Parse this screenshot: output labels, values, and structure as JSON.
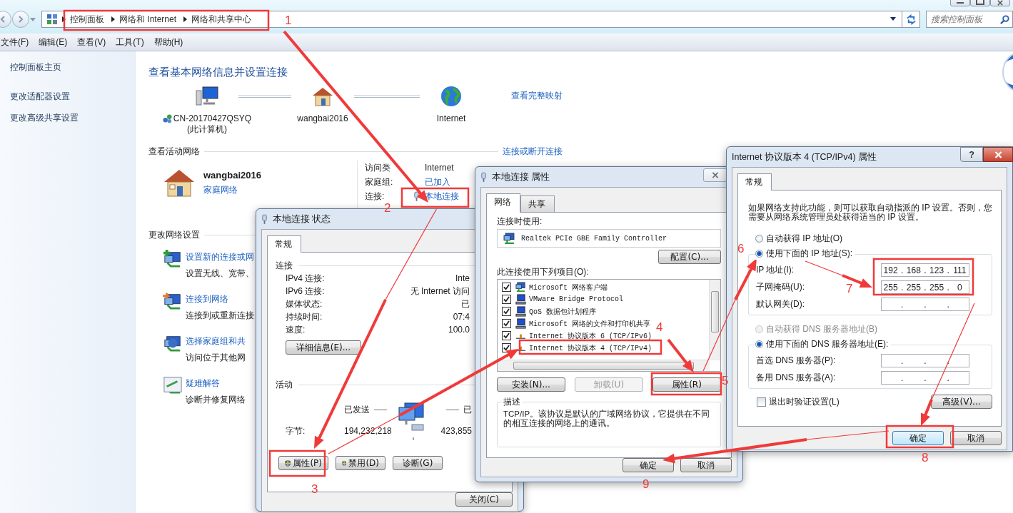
{
  "address_bar": {
    "breadcrumbs": [
      "控制面板",
      "网络和 Internet",
      "网络和共享中心"
    ]
  },
  "search": {
    "placeholder": "搜索控制面板"
  },
  "menu": [
    "文件(F)",
    "编辑(E)",
    "查看(V)",
    "工具(T)",
    "帮助(H)"
  ],
  "sidebar": {
    "items": [
      "控制面板主页",
      "更改适配器设置",
      "更改高级共享设置"
    ]
  },
  "main": {
    "title": "查看基本网络信息并设置连接",
    "full_map_link": "查看完整映射",
    "map_nodes": [
      {
        "kind": "computer",
        "label": "CN-20170427QSYQ",
        "sublabel": "(此计算机)"
      },
      {
        "kind": "home",
        "label": "wangbai2016"
      },
      {
        "kind": "internet",
        "label": "Internet"
      }
    ],
    "active_heading": "查看活动网络",
    "connect_link": "连接或断开连接",
    "network": {
      "name": "wangbai2016",
      "type": "家庭网络"
    },
    "details": [
      {
        "kind": "text",
        "label": "访问类",
        "value": "Internet"
      },
      {
        "kind": "link",
        "label": "家庭组:",
        "value": "已加入"
      },
      {
        "kind": "connection",
        "label": "连接:",
        "value": "本地连接"
      }
    ],
    "settings_heading": "更改网络设置",
    "tasks": [
      {
        "kind": "new",
        "title": "设置新的连接或网",
        "desc": "设置无线、宽带、"
      },
      {
        "kind": "connect",
        "title": "连接到网络",
        "desc": "连接到或重新连接"
      },
      {
        "kind": "homegroup",
        "title": "选择家庭组和共",
        "desc": "访问位于其他网"
      },
      {
        "kind": "troubleshoot",
        "title": "疑难解答",
        "desc": "诊断并修复网络"
      }
    ]
  },
  "status_dialog": {
    "title": "本地连接 状态",
    "tabs": [
      {
        "label": "常规",
        "selected": true
      }
    ],
    "connection_heading": "连接",
    "rows": [
      {
        "label": "IPv4 连接:",
        "value": "Inte"
      },
      {
        "label": "IPv6 连接:",
        "value": "无 Internet 访问"
      },
      {
        "label": "媒体状态:",
        "value": "已"
      },
      {
        "label": "持续时间:",
        "value": "07:4"
      },
      {
        "label": "速度:",
        "value": "100.0"
      }
    ],
    "details_button": "详细信息(E)...",
    "activity_heading": "活动",
    "sent_label": "已发送",
    "received_label": "已",
    "bytes_label": "字节:",
    "bytes_sent": "194,232,218",
    "bytes_received": "423,855",
    "buttons": [
      {
        "label": "属性(P)",
        "shield": true
      },
      {
        "label": "禁用(D)",
        "shield": true
      },
      {
        "label": "诊断(G)",
        "shield": false
      }
    ],
    "close_button": "关闭(C)"
  },
  "props_dialog": {
    "title": "本地连接 属性",
    "tabs": [
      {
        "label": "网络",
        "selected": true
      },
      {
        "label": "共享",
        "selected": false
      }
    ],
    "connect_using_label": "连接时使用:",
    "adapter": "Realtek PCIe GBE Family Controller",
    "configure_button": "配置(C)...",
    "items_label": "此连接使用下列项目(O):",
    "items": [
      {
        "kind": "client",
        "label": "Microsoft 网络客户端",
        "checked": true
      },
      {
        "kind": "service",
        "label": "VMware Bridge Protocol",
        "checked": true
      },
      {
        "kind": "service",
        "label": "QoS 数据包计划程序",
        "checked": true
      },
      {
        "kind": "service",
        "label": "Microsoft 网络的文件和打印机共享",
        "checked": true
      },
      {
        "kind": "protocol",
        "label": "Internet 协议版本 6 (TCP/IPv6)",
        "checked": true
      },
      {
        "kind": "protocol",
        "label": "Internet 协议版本 4 (TCP/IPv4)",
        "checked": true
      }
    ],
    "buttons": [
      {
        "label": "安装(N)...",
        "disabled": false
      },
      {
        "label": "卸载(U)",
        "disabled": true
      },
      {
        "label": "属性(R)",
        "disabled": false
      }
    ],
    "description_heading": "描述",
    "description": "TCP/IP。该协议是默认的广域网络协议，它提供在不同的相互连接的网络上的通讯。",
    "ok_button": "确定",
    "cancel_button": "取消"
  },
  "ipv4_dialog": {
    "title": "Internet 协议版本 4 (TCP/IPv4) 属性",
    "help_button": "?",
    "tabs": [
      {
        "label": "常规",
        "selected": true
      }
    ],
    "intro": "如果网络支持此功能，则可以获取自动指派的 IP 设置。否则，您需要从网络系统管理员处获得适当的 IP 设置。",
    "separator": ".",
    "ip_options": [
      {
        "label": "自动获得 IP 地址(O)",
        "selected": false,
        "disabled": false
      },
      {
        "label": "使用下面的 IP 地址(S):",
        "selected": true,
        "disabled": false
      }
    ],
    "ip_fields": [
      {
        "label": "IP 地址(I):",
        "octets": [
          "192",
          "168",
          "123",
          "111"
        ]
      },
      {
        "label": "子网掩码(U):",
        "octets": [
          "255",
          "255",
          "255",
          "0"
        ]
      },
      {
        "label": "默认网关(D):"
      }
    ],
    "dns_options": [
      {
        "label": "自动获得 DNS 服务器地址(B)",
        "selected": false,
        "disabled": true
      },
      {
        "label": "使用下面的 DNS 服务器地址(E):",
        "selected": true,
        "disabled": false
      }
    ],
    "dns_fields": [
      {
        "label": "首选 DNS 服务器(P):"
      },
      {
        "label": "备用 DNS 服务器(A):"
      }
    ],
    "validate_checkbox": {
      "label": "退出时验证设置(L)",
      "checked": false
    },
    "advanced_button": "高级(V)...",
    "ok_button": "确定",
    "cancel_button": "取消"
  },
  "annotations": {
    "steps": [
      "1",
      "2",
      "3",
      "4",
      "5",
      "6",
      "7",
      "8",
      "9"
    ]
  }
}
